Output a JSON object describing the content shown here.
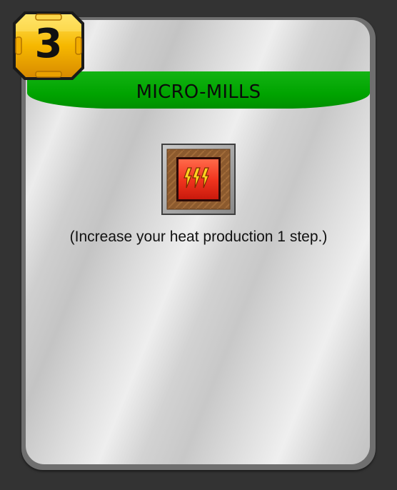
{
  "card": {
    "cost": "3",
    "title": "MICRO-MILLS",
    "production_icon": "heat-production-icon",
    "effect_text": "(Increase your heat production 1 step.)"
  },
  "colors": {
    "background": "#333333",
    "title_bar": "#00a400",
    "cost_badge": "#f2b705",
    "heat_tile": "#e8281b"
  }
}
